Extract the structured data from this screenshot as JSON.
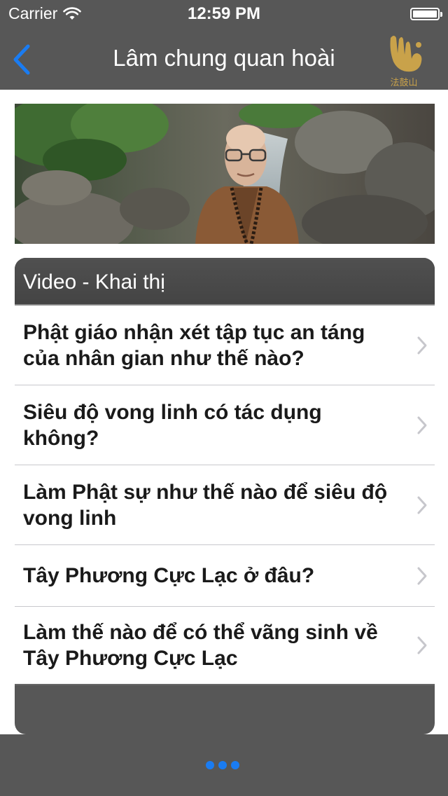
{
  "status_bar": {
    "carrier": "Carrier",
    "time": "12:59 PM",
    "battery_level": 1.0
  },
  "nav_bar": {
    "title": "Lâm chung quan hoài",
    "back_icon": "chevron-left-icon",
    "logo_text": "法鼓山",
    "accent_color": "#1a7cf2",
    "logo_color": "#c9a24a"
  },
  "section": {
    "title": "Video - Khai thị"
  },
  "items": [
    {
      "label": "Phật giáo nhận xét tập tục an táng của nhân gian như thế nào?"
    },
    {
      "label": "Siêu độ vong linh có tác dụng không?"
    },
    {
      "label": "Làm Phật sự như thế nào để siêu độ vong linh"
    },
    {
      "label": "Tây Phương Cực Lạc ở đâu?"
    },
    {
      "label": "Làm thế nào để có thể vãng sinh về Tây Phương Cực Lạc"
    }
  ],
  "tab_bar": {
    "more_icon": "more-dots-icon"
  }
}
